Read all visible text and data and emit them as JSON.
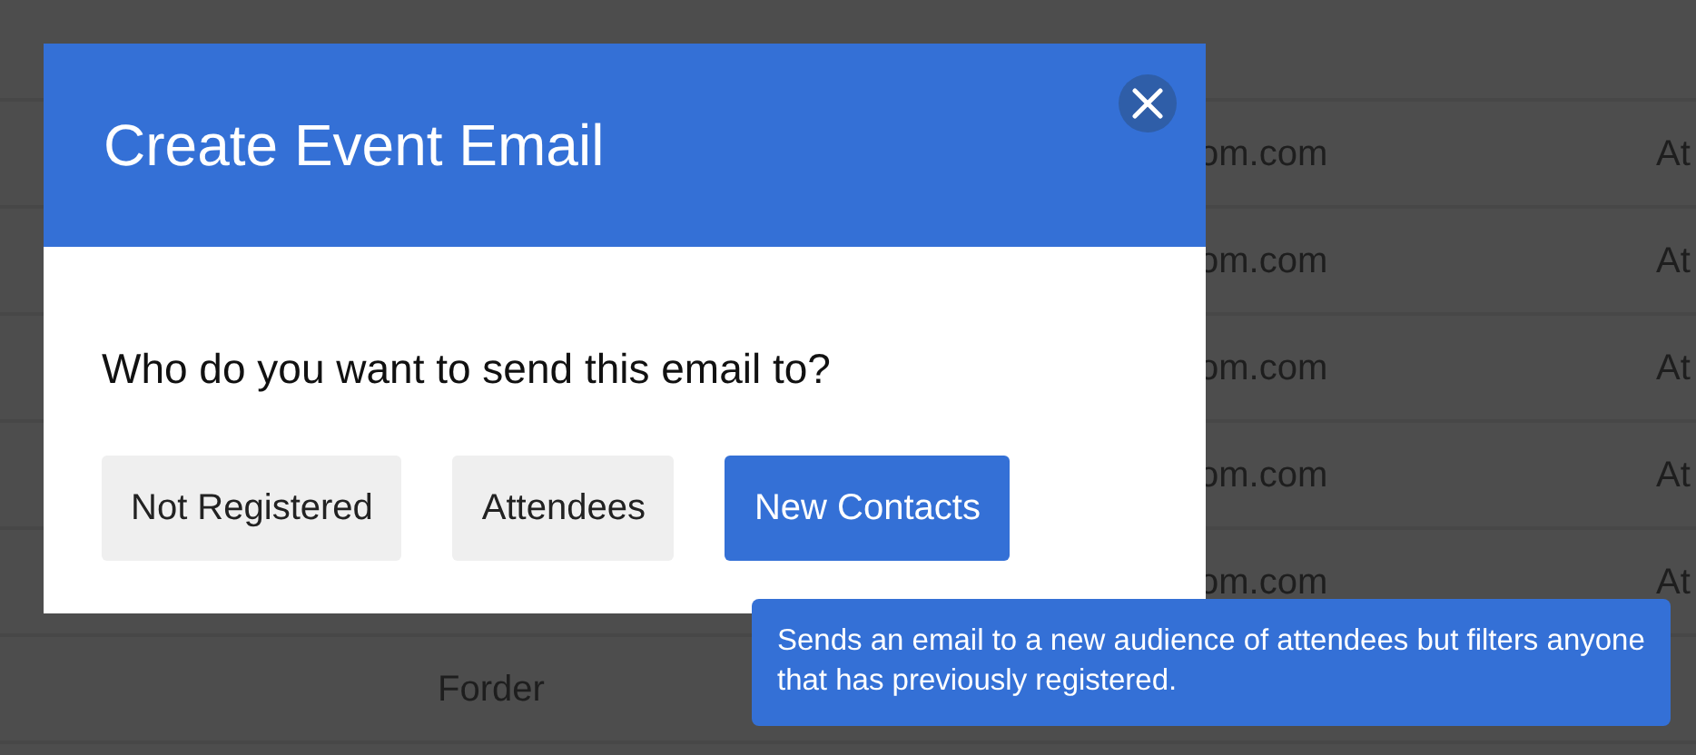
{
  "table": {
    "rows": [
      {
        "name": "",
        "email": "om.com",
        "status": "At"
      },
      {
        "name": "",
        "email": "om.com",
        "status": "At"
      },
      {
        "name": "",
        "email": "om.com",
        "status": "At"
      },
      {
        "name": "",
        "email": "om.com",
        "status": "At"
      },
      {
        "name": "",
        "email": "om.com",
        "status": "At"
      },
      {
        "name": "Forder",
        "email": "",
        "status": ""
      }
    ]
  },
  "modal": {
    "title": "Create Event Email",
    "question": "Who do you want to send this email to?",
    "buttons": [
      {
        "label": "Not Registered",
        "selected": false
      },
      {
        "label": "Attendees",
        "selected": false
      },
      {
        "label": "New Contacts",
        "selected": true
      }
    ]
  },
  "tooltip": {
    "text": "Sends an email to a new audience of attendees but filters anyone that has previously registered."
  }
}
